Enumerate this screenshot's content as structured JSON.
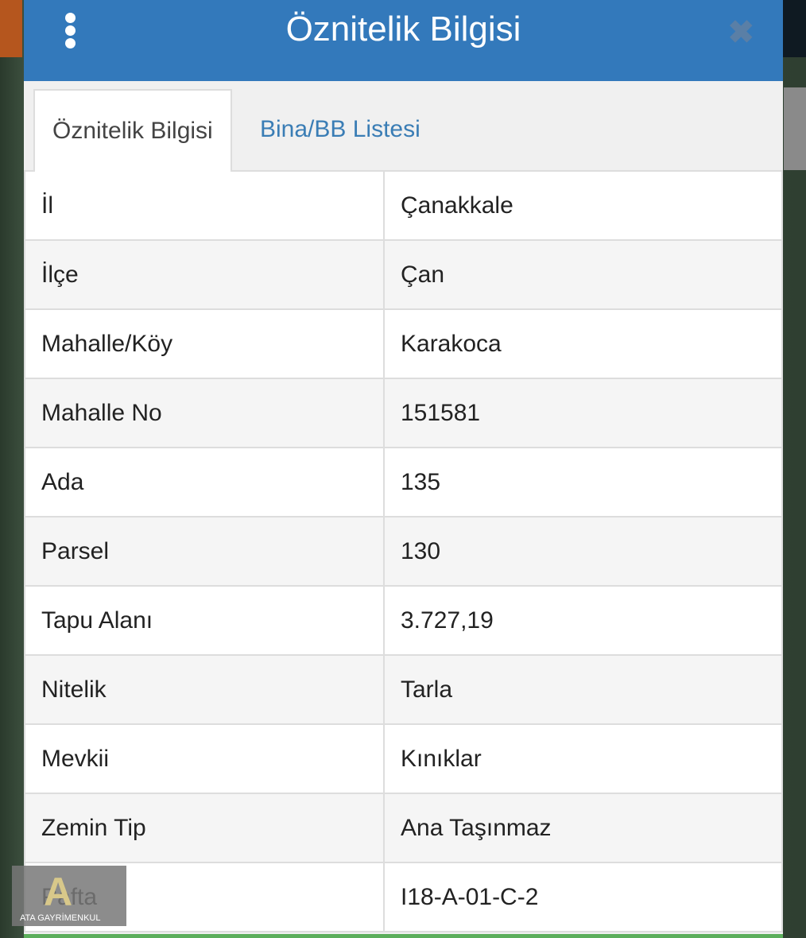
{
  "header": {
    "title": "Öznitelik Bilgisi"
  },
  "tabs": [
    {
      "label": "Öznitelik Bilgisi",
      "active": true
    },
    {
      "label": "Bina/BB Listesi",
      "active": false
    }
  ],
  "rows": [
    {
      "key": "İl",
      "value": "Çanakkale"
    },
    {
      "key": "İlçe",
      "value": "Çan"
    },
    {
      "key": "Mahalle/Köy",
      "value": "Karakoca"
    },
    {
      "key": "Mahalle No",
      "value": "151581"
    },
    {
      "key": "Ada",
      "value": "135"
    },
    {
      "key": "Parsel",
      "value": "130"
    },
    {
      "key": "Tapu Alanı",
      "value": "3.727,19"
    },
    {
      "key": "Nitelik",
      "value": "Tarla"
    },
    {
      "key": "Mevkii",
      "value": "Kınıklar"
    },
    {
      "key": "Zemin Tip",
      "value": "Ana Taşınmaz"
    },
    {
      "key": "Pafta",
      "value": "I18-A-01-C-2"
    }
  ],
  "watermark": {
    "logo_text": "ATA GAYRİMENKUL"
  },
  "colors": {
    "header": "#3379bb",
    "tab_link": "#3a7db5",
    "accent_bar": "#5cae5c"
  }
}
